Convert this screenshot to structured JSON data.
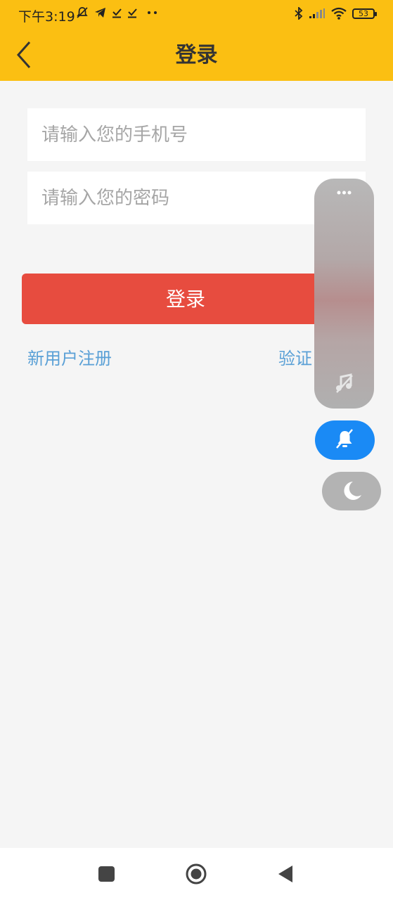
{
  "status_bar": {
    "time": "下午3:19",
    "left_icons": [
      "bell-off-icon",
      "telegram-icon",
      "download-done-icon",
      "download-done-icon",
      "more-dots-icon"
    ],
    "right_icons": [
      "bluetooth-icon",
      "signal-icon",
      "wifi-icon",
      "battery-icon"
    ],
    "battery_level": "53"
  },
  "app_bar": {
    "title": "登录",
    "back_icon": "chevron-left-icon"
  },
  "form": {
    "phone_placeholder": "请输入您的手机号",
    "phone_value": "",
    "password_placeholder": "请输入您的密码",
    "password_value": "",
    "login_label": "登录",
    "register_link": "新用户注册",
    "verify_link": "验证"
  },
  "floating_panel": {
    "more_icon": "more-dots-icon",
    "music_icon": "music-note-off-icon",
    "mute_icon": "bell-off-icon",
    "night_icon": "moon-icon"
  },
  "nav_bar": {
    "icons": [
      "recent-apps-icon",
      "home-icon",
      "back-icon"
    ]
  },
  "colors": {
    "accent_yellow": "#fbbf12",
    "login_red": "#e74c3f",
    "link_blue": "#5aa0d6",
    "mute_blue": "#1a8af5"
  }
}
